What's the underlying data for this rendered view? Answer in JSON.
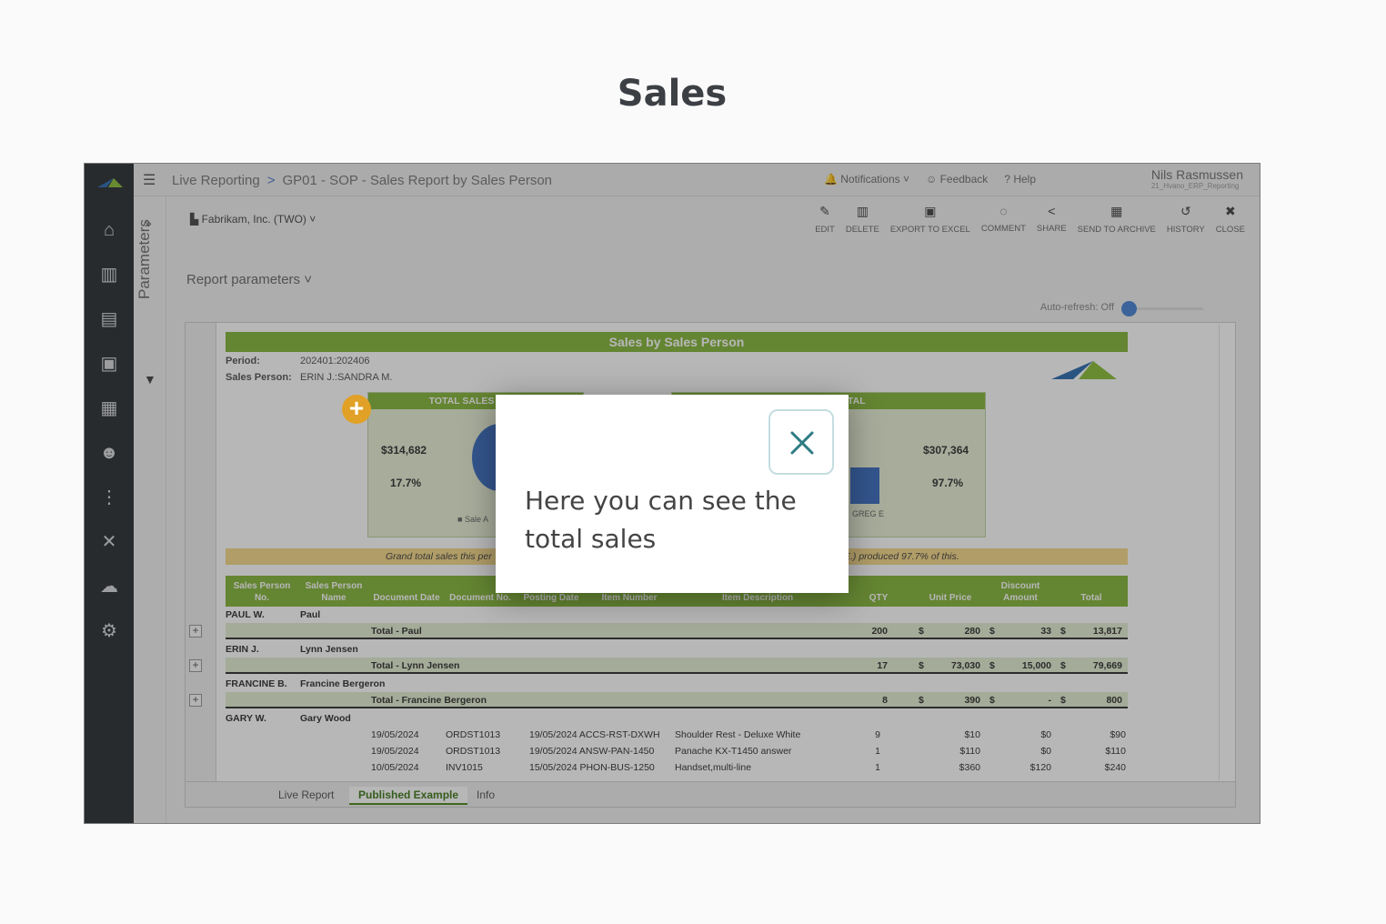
{
  "page": {
    "title": "Sales"
  },
  "app": {
    "breadcrumb": [
      "Live Reporting",
      "GP01 - SOP - Sales Report by Sales Person"
    ],
    "breadcrumb_sep": ">",
    "nav": {
      "notifications": "Notifications",
      "feedback": "Feedback",
      "help": "Help"
    },
    "user": {
      "name": "Nils Rasmussen",
      "sub": "21_Hvano_ERP_Reporting"
    },
    "parameters_label": "Parameters",
    "company": "Fabrikam, Inc. (TWO)",
    "toolbar": [
      "EDIT",
      "DELETE",
      "EXPORT TO EXCEL",
      "COMMENT",
      "SHARE",
      "SEND TO ARCHIVE",
      "HISTORY",
      "CLOSE"
    ],
    "report_parameters": "Report parameters",
    "auto_refresh": "Auto-refresh: Off"
  },
  "report": {
    "title": "Sales by Sales Person",
    "period_label": "Period:",
    "period": "202401:202406",
    "person_label": "Sales Person:",
    "person": "ERIN J.:SANDRA M.",
    "chart1": {
      "header": "TOTAL SALES & DIS",
      "value": "$314,682",
      "pct": "17.7%",
      "legend": "Sale A"
    },
    "chart2": {
      "header": "AS % OF TOTAL",
      "value": "$307,364",
      "pct": "97.7%",
      "legend": "GREG E"
    },
    "banner_left": "Grand total sales this per",
    "banner_right": "E.) produced 97.7% of this.",
    "columns": [
      "Sales Person No.",
      "Sales Person Name",
      "Document Date",
      "Document No.",
      "Posting Date",
      "Item Number",
      "Item Description",
      "QTY",
      "Unit Price",
      "Discount Amount",
      "Total"
    ],
    "groups": [
      {
        "no": "PAUL W.",
        "name": "Paul",
        "total_label": "Total - Paul",
        "qty": "200",
        "price": "280",
        "discount": "33",
        "total": "13,817"
      },
      {
        "no": "ERIN J.",
        "name": "Lynn Jensen",
        "total_label": "Total - Lynn Jensen",
        "qty": "17",
        "price": "73,030",
        "discount": "15,000",
        "total": "79,669"
      },
      {
        "no": "FRANCINE B.",
        "name": "Francine Bergeron",
        "total_label": "Total - Francine Bergeron",
        "qty": "8",
        "price": "390",
        "discount": "-",
        "total": "800"
      }
    ],
    "last_group": {
      "no": "GARY W.",
      "name": "Gary Wood"
    },
    "detail_rows": [
      {
        "doc_date": "19/05/2024",
        "doc_no": "ORDST1013",
        "post_item": "19/05/2024 ACCS-RST-DXWH",
        "desc": "Shoulder Rest - Deluxe White",
        "qty": "9",
        "price": "$10",
        "discount": "$0",
        "total": "$90"
      },
      {
        "doc_date": "19/05/2024",
        "doc_no": "ORDST1013",
        "post_item": "19/05/2024 ANSW-PAN-1450",
        "desc": "Panache KX-T1450 answer",
        "qty": "1",
        "price": "$110",
        "discount": "$0",
        "total": "$110"
      },
      {
        "doc_date": "10/05/2024",
        "doc_no": "INV1015",
        "post_item": "15/05/2024 PHON-BUS-1250",
        "desc": "Handset,multi-line",
        "qty": "1",
        "price": "$360",
        "discount": "$120",
        "total": "$240"
      }
    ],
    "dollar": "$",
    "tabs": [
      "Live Report",
      "Published Example",
      "Info"
    ]
  },
  "popup": {
    "message": "Here you can see the total sales"
  },
  "colors": {
    "accent": "#85b53c",
    "rail": "#2d3136",
    "badge": "#e1a126",
    "close": "#2e7b84"
  }
}
